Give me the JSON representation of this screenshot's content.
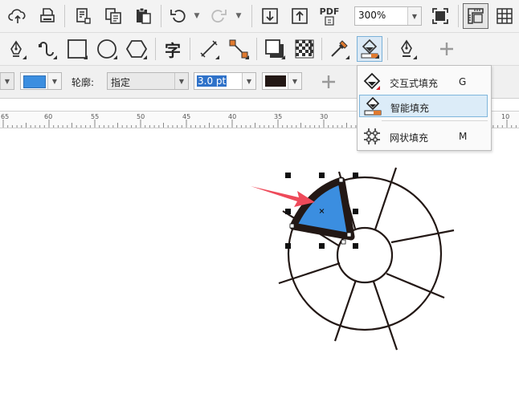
{
  "toolbar_main": {
    "zoom_value": "300%",
    "pdf_label": "PDF",
    "icons": [
      "cloud-upload-icon",
      "print-icon",
      "page-layout-icon",
      "copy-icon",
      "paste-icon",
      "undo-icon",
      "redo-icon",
      "import-icon",
      "export-icon",
      "publish-pdf-icon",
      "full-screen-icon",
      "show-rulers-icon",
      "show-grid-icon"
    ]
  },
  "toolbar_tools": {
    "glyph_text_tool": "字",
    "icons": [
      "pen-tool-icon",
      "curve-tool-icon",
      "rectangle-tool-icon",
      "ellipse-tool-icon",
      "polygon-tool-icon",
      "text-tool-icon",
      "dimension-tool-icon",
      "connector-tool-icon",
      "drop-shadow-tool-icon",
      "transparency-tool-icon",
      "eyedropper-tool-icon",
      "smart-fill-tool-icon",
      "outline-pen-tool-icon",
      "add-tool-icon"
    ]
  },
  "property_bar": {
    "fill_color": "#3b8ee0",
    "outline_label": "轮廓:",
    "outline_option": "指定",
    "outline_width": "3.0 pt",
    "outline_color": "#231815"
  },
  "ruler": {
    "labels": [
      "65",
      "60",
      "55",
      "50",
      "45",
      "40",
      "35",
      "30",
      "10"
    ]
  },
  "fill_menu": {
    "items": [
      {
        "label": "交互式填充",
        "shortcut": "G",
        "icon": "interactive-fill-icon"
      },
      {
        "label": "智能填充",
        "shortcut": "",
        "icon": "smart-fill-icon",
        "selected": true
      },
      {
        "label": "网状填充",
        "shortcut": "M",
        "icon": "mesh-fill-icon"
      }
    ]
  },
  "canvas": {
    "shape_fill": "#3b8ee0",
    "shape_outline": "#231815",
    "arrow_color": "#ee4a5a"
  }
}
